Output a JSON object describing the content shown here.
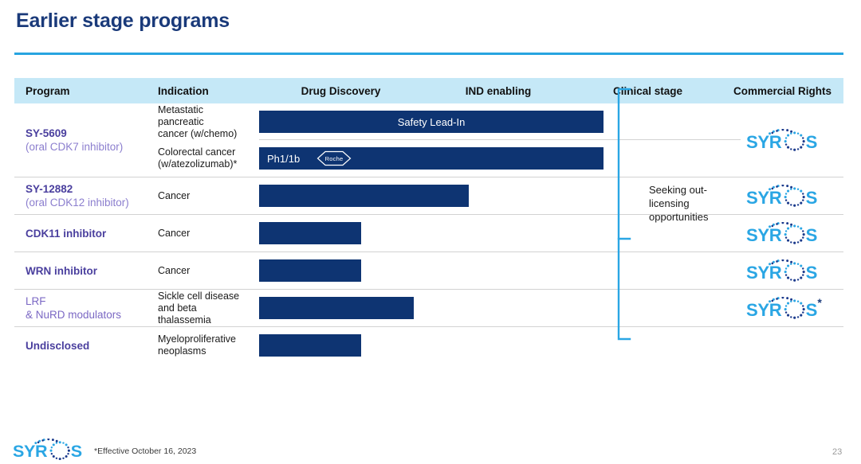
{
  "slide": {
    "title": "Earlier stage programs",
    "page_number": "23",
    "footnote": "*Effective October 16, 2023",
    "accent_color": "#27a4e0",
    "title_color": "#1a3a7a",
    "bar_color": "#0e3472",
    "header_band_color": "#c5e8f7",
    "program_color": "#7b68c4",
    "logo_text": "SYROS"
  },
  "table": {
    "columns": [
      {
        "key": "program",
        "label": "Program"
      },
      {
        "key": "indication",
        "label": "Indication"
      },
      {
        "key": "discovery",
        "label": "Drug Discovery"
      },
      {
        "key": "ind",
        "label": "IND enabling"
      },
      {
        "key": "clinical",
        "label": "Clinical stage"
      },
      {
        "key": "rights",
        "label": "Commercial Rights"
      }
    ],
    "rows": [
      {
        "program_name": "SY-5609",
        "program_sub": "(oral CDK7 inhibitor)",
        "sub_rows": [
          {
            "indication_lines": [
              "Metastatic",
              "pancreatic",
              "cancer  (w/chemo)"
            ],
            "bar_label": "Safety Lead-In",
            "bar_label_align": "center",
            "bar_start_pct": 0,
            "bar_width_pct": 74.5,
            "badge": null
          },
          {
            "indication_lines": [
              "Colorectal cancer",
              "(w/atezolizumab)*"
            ],
            "bar_label": "Ph1/1b",
            "bar_label_align": "left",
            "bar_start_pct": 0,
            "bar_width_pct": 74.5,
            "badge": "Roche"
          }
        ],
        "rights_logo": "SYROS",
        "rights_asterisk": false
      },
      {
        "program_name": "SY-12882",
        "program_sub": "(oral CDK12 inhibitor)",
        "sub_rows": [
          {
            "indication_lines": [
              "Cancer"
            ],
            "bar_label": "",
            "bar_label_align": "center",
            "bar_start_pct": 0,
            "bar_width_pct": 45.4,
            "badge": null
          }
        ],
        "rights_logo": "SYROS",
        "rights_asterisk": false
      },
      {
        "program_name": "CDK11 inhibitor",
        "program_sub": "",
        "sub_rows": [
          {
            "indication_lines": [
              "Cancer"
            ],
            "bar_label": "",
            "bar_label_align": "center",
            "bar_start_pct": 0,
            "bar_width_pct": 22.1,
            "badge": null
          }
        ],
        "rights_logo": "SYROS",
        "rights_asterisk": false
      },
      {
        "program_name": "WRN inhibitor",
        "program_sub": "",
        "sub_rows": [
          {
            "indication_lines": [
              "Cancer"
            ],
            "bar_label": "",
            "bar_label_align": "center",
            "bar_start_pct": 0,
            "bar_width_pct": 22.1,
            "badge": null
          }
        ],
        "rights_logo": "SYROS",
        "rights_asterisk": false
      },
      {
        "program_name": "LRF",
        "program_sub": "& NuRD modulators",
        "program_plain": true,
        "sub_rows": [
          {
            "indication_lines": [
              "Sickle cell disease",
              "and beta",
              "thalassemia"
            ],
            "bar_label": "",
            "bar_label_align": "center",
            "bar_start_pct": 0,
            "bar_width_pct": 33.4,
            "badge": null
          }
        ],
        "rights_logo": "SYROS",
        "rights_asterisk": true
      },
      {
        "program_name": "Undisclosed",
        "program_sub": "",
        "sub_rows": [
          {
            "indication_lines": [
              "Myeloproliferative",
              "neoplasms"
            ],
            "bar_label": "",
            "bar_label_align": "center",
            "bar_start_pct": 0,
            "bar_width_pct": 22.1,
            "badge": null
          }
        ],
        "rights_logo": "",
        "rights_asterisk": false
      }
    ]
  },
  "annotation": {
    "seeking_text": "Seeking out-licensing opportunities",
    "seeking_lines": [
      "Seeking out-",
      "licensing",
      "opportunities"
    ],
    "bracket_color": "#2aa6e4"
  }
}
